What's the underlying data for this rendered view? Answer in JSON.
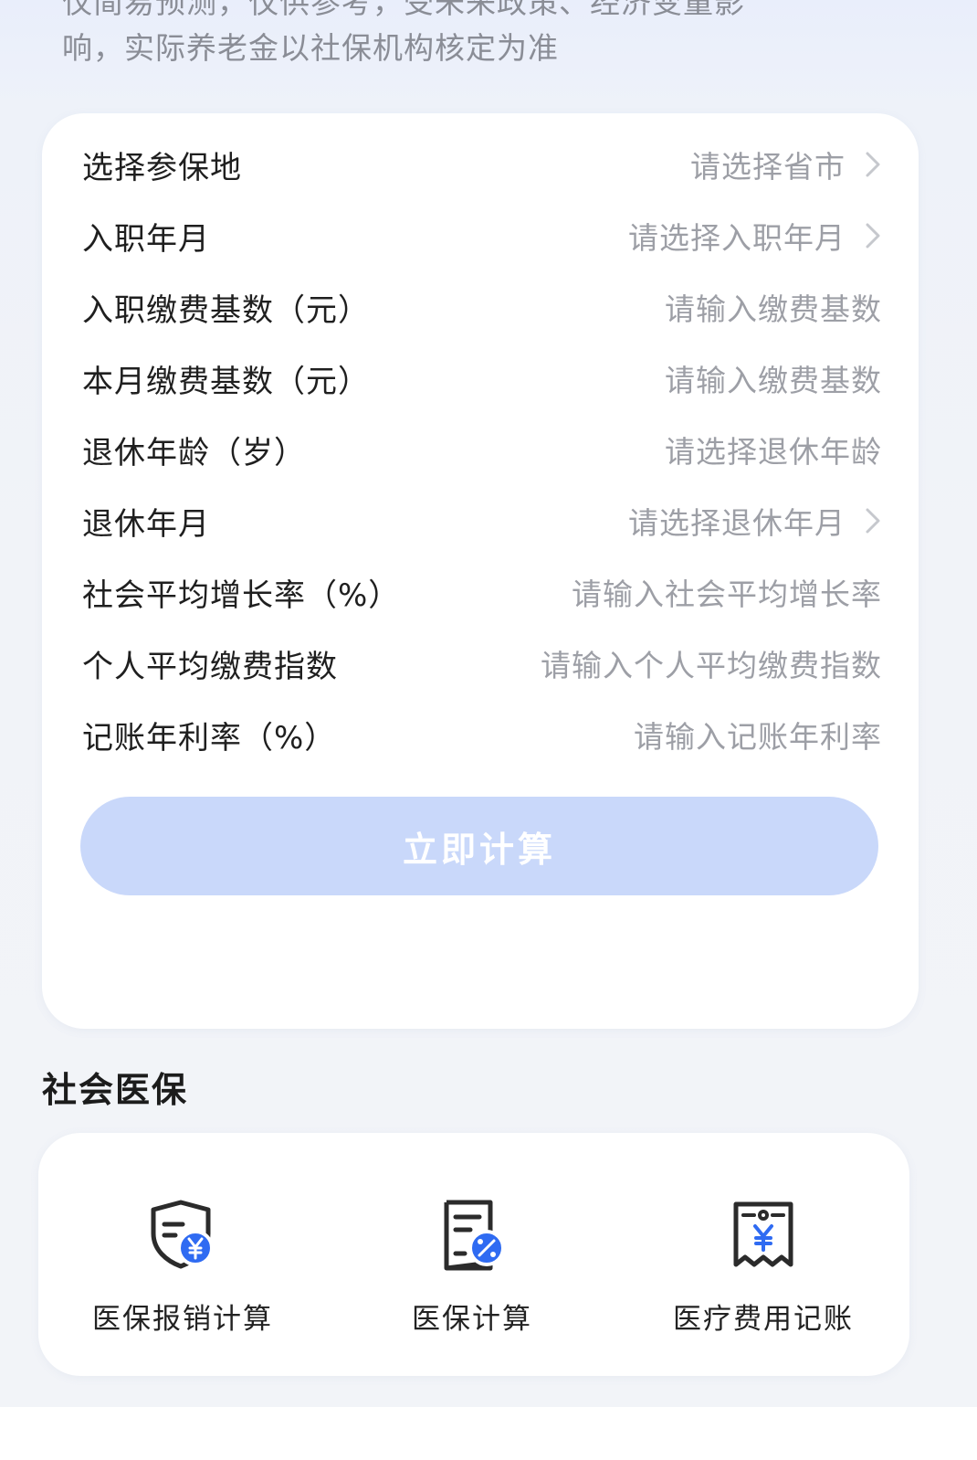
{
  "disclaimer": {
    "line1": "仅简易预测，仅供参考，受未来政策、经济变量影",
    "line2": "响，实际养老金以社保机构核定为准"
  },
  "form": {
    "rows": [
      {
        "label": "选择参保地",
        "placeholder": "请选择省市",
        "has_arrow": true
      },
      {
        "label": "入职年月",
        "placeholder": "请选择入职年月",
        "has_arrow": true
      },
      {
        "label": "入职缴费基数（元）",
        "placeholder": "请输入缴费基数",
        "has_arrow": false
      },
      {
        "label": "本月缴费基数（元）",
        "placeholder": "请输入缴费基数",
        "has_arrow": false
      },
      {
        "label": "退休年龄（岁）",
        "placeholder": "请选择退休年龄",
        "has_arrow": false
      },
      {
        "label": "退休年月",
        "placeholder": "请选择退休年月",
        "has_arrow": true
      },
      {
        "label": "社会平均增长率（%）",
        "placeholder": "请输入社会平均增长率",
        "has_arrow": false
      },
      {
        "label": "个人平均缴费指数",
        "placeholder": "请输入个人平均缴费指数",
        "has_arrow": false
      },
      {
        "label": "记账年利率（%）",
        "placeholder": "请输入记账年利率",
        "has_arrow": false
      }
    ],
    "submit_label": "立即计算"
  },
  "medical": {
    "section_title": "社会医保",
    "items": [
      {
        "label": "医保报销计算",
        "icon": "shield-yuan-icon"
      },
      {
        "label": "医保计算",
        "icon": "document-percent-icon"
      },
      {
        "label": "医疗费用记账",
        "icon": "receipt-yuan-icon"
      }
    ]
  },
  "colors": {
    "accent": "#2f6bf2",
    "button_disabled": "#c9d8fa",
    "placeholder": "#9d9fa6",
    "label": "#1f1f1f"
  }
}
